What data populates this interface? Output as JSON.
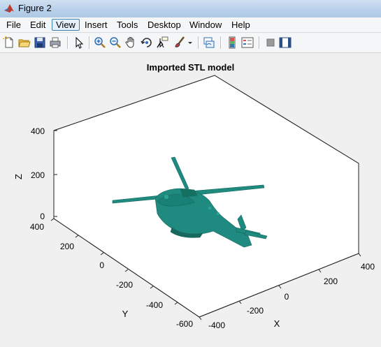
{
  "window": {
    "title": "Figure 2"
  },
  "menu": [
    {
      "label": "File"
    },
    {
      "label": "Edit"
    },
    {
      "label": "View",
      "active": true
    },
    {
      "label": "Insert"
    },
    {
      "label": "Tools"
    },
    {
      "label": "Desktop"
    },
    {
      "label": "Window"
    },
    {
      "label": "Help"
    }
  ],
  "toolbar": {
    "buttons": [
      "new-figure-icon",
      "open-file-icon",
      "save-icon",
      "print-icon",
      "edit-plot-arrow-icon",
      "zoom-in-icon",
      "zoom-out-icon",
      "pan-hand-icon",
      "rotate-3d-icon",
      "data-cursor-icon",
      "brush-icon",
      "brush-dropdown-icon",
      "link-plot-icon",
      "colorbar-icon",
      "legend-icon",
      "hide-plot-tools-icon",
      "show-plot-tools-icon"
    ]
  },
  "plot": {
    "title": "Imported STL model",
    "xlabel": "X",
    "ylabel": "Y",
    "zlabel": "Z",
    "z_ticks": [
      "0",
      "200",
      "400"
    ],
    "y_ticks": [
      "400",
      "200",
      "0",
      "-200",
      "-400",
      "-600"
    ],
    "x_ticks": [
      "-400",
      "-200",
      "0",
      "200",
      "400"
    ],
    "model_color": "#1f8a7f"
  }
}
